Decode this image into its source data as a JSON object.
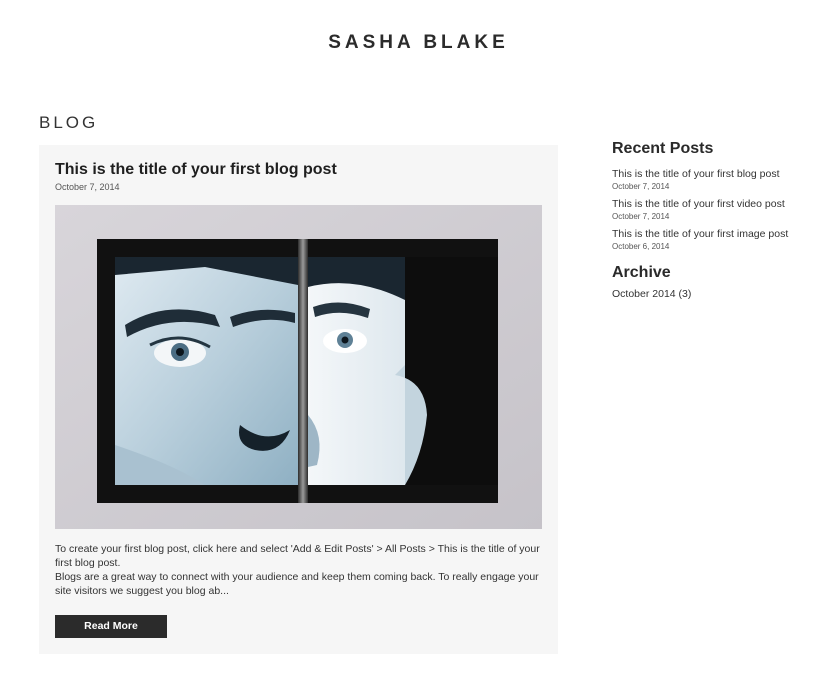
{
  "site": {
    "title": "SASHA BLAKE"
  },
  "blog": {
    "heading": "BLOG",
    "post": {
      "title": "This is the title of your first blog post",
      "date": "October 7, 2014",
      "excerpt_line1": "To create your first blog post, click here and select 'Add & Edit Posts' > All Posts > This is the title of your first blog post.",
      "excerpt_line2": "Blogs are a great way to connect with your audience and keep them coming back. To really engage your site visitors we suggest you blog ab...",
      "read_more_label": "Read More"
    }
  },
  "sidebar": {
    "recent_heading": "Recent Posts",
    "recent_posts": [
      {
        "title": "This is the title of your first blog post",
        "date": "October 7, 2014"
      },
      {
        "title": "This is the title of your first video post",
        "date": "October 7, 2014"
      },
      {
        "title": "This is the title of your first image post",
        "date": "October 6, 2014"
      }
    ],
    "archive_heading": "Archive",
    "archive_items": [
      {
        "label": "October 2014 (3)"
      }
    ]
  }
}
